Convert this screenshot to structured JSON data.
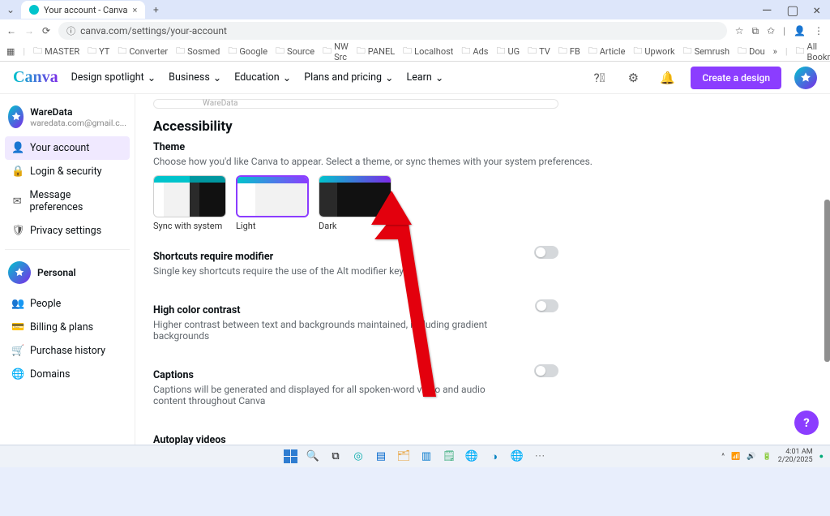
{
  "browser": {
    "tab_title": "Your account - Canva",
    "url": "canva.com/settings/your-account",
    "bookmarks": [
      "MASTER",
      "YT",
      "Converter",
      "Sosmed",
      "Google",
      "Source",
      "NW Src",
      "PANEL",
      "Localhost",
      "Ads",
      "UG",
      "TV",
      "FB",
      "Article",
      "Upwork",
      "Semrush",
      "Dou"
    ],
    "all_bookmarks": "All Bookmarks"
  },
  "header": {
    "logo": "Canva",
    "nav": [
      "Design spotlight",
      "Business",
      "Education",
      "Plans and pricing",
      "Learn"
    ],
    "cta": "Create a design"
  },
  "sidebar": {
    "user_name": "WareData",
    "user_email": "waredata.com@gmail.c...",
    "items": [
      {
        "icon": "👤",
        "label": "Your account"
      },
      {
        "icon": "🔒",
        "label": "Login & security"
      },
      {
        "icon": "✉",
        "label": "Message preferences"
      },
      {
        "icon": "🛡",
        "label": "Privacy settings"
      }
    ],
    "team_label": "Personal",
    "team_items": [
      {
        "icon": "👥",
        "label": "People"
      },
      {
        "icon": "💳",
        "label": "Billing & plans"
      },
      {
        "icon": "🛒",
        "label": "Purchase history"
      },
      {
        "icon": "🌐",
        "label": "Domains"
      }
    ]
  },
  "content": {
    "partial_input": "WareData",
    "accessibility_heading": "Accessibility",
    "theme": {
      "label": "Theme",
      "desc": "Choose how you'd like Canva to appear. Select a theme, or sync themes with your system preferences.",
      "options": [
        "Sync with system",
        "Light",
        "Dark"
      ],
      "selected": "Light"
    },
    "shortcuts": {
      "label": "Shortcuts require modifier",
      "desc": "Single key shortcuts require the use of the Alt modifier key"
    },
    "contrast": {
      "label": "High color contrast",
      "desc": "Higher contrast between text and backgrounds maintained, including gradient backgrounds"
    },
    "captions": {
      "label": "Captions",
      "desc": "Captions will be generated and displayed for all spoken-word video and audio content throughout Canva"
    },
    "autoplay": {
      "label": "Autoplay videos"
    }
  },
  "fab": "?",
  "taskbar": {
    "time": "4:01 AM",
    "date": "2/20/2025"
  }
}
